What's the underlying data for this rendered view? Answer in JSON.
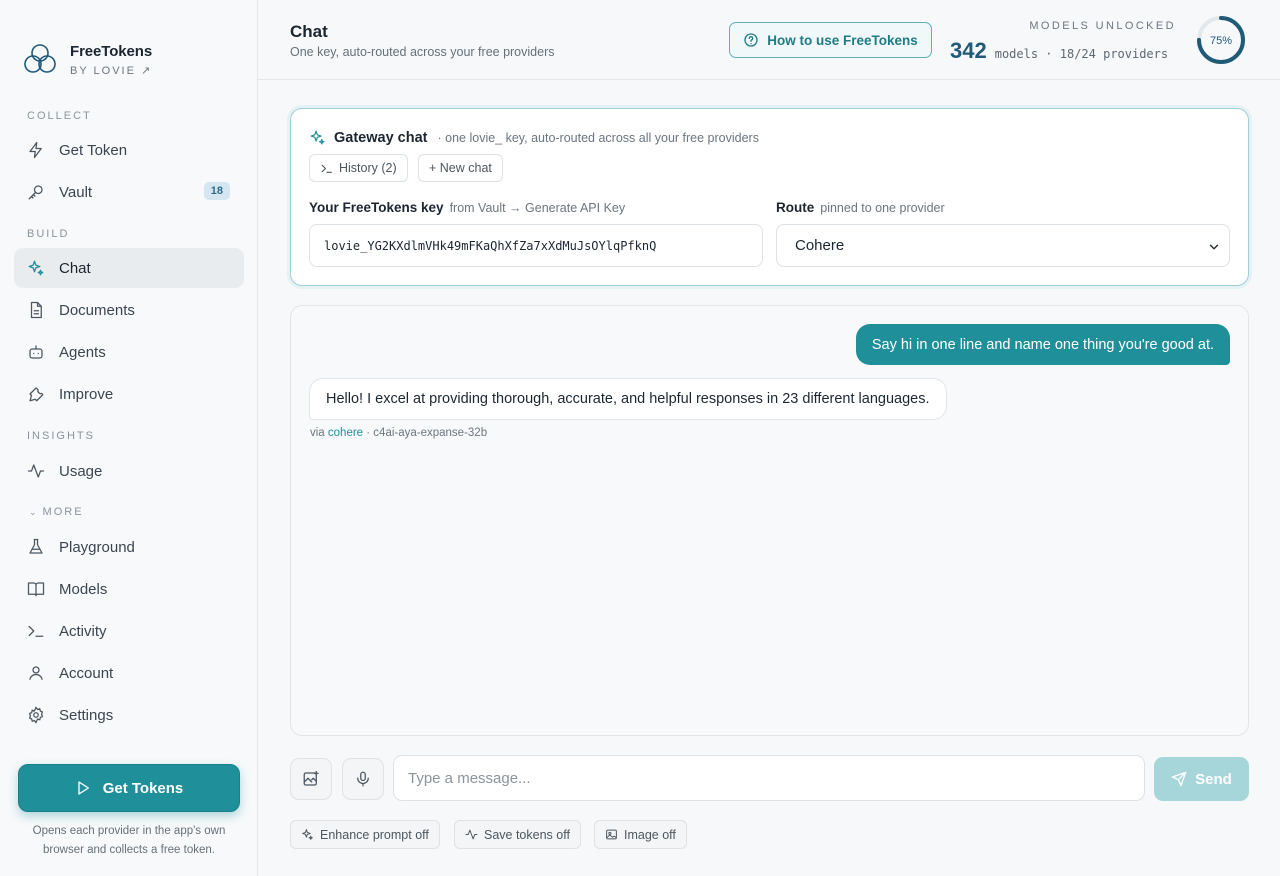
{
  "brand": {
    "name": "FreeTokens",
    "sub": "BY LOVIE ↗"
  },
  "sidebar": {
    "sections": {
      "collect": "COLLECT",
      "build": "BUILD",
      "insights": "INSIGHTS",
      "more": "MORE"
    },
    "items": [
      {
        "label": "Get Token",
        "icon": "lightning-icon"
      },
      {
        "label": "Vault",
        "icon": "key-icon",
        "badge": "18"
      },
      {
        "label": "Chat",
        "icon": "sparkles-icon",
        "active": true
      },
      {
        "label": "Documents",
        "icon": "document-icon"
      },
      {
        "label": "Agents",
        "icon": "robot-icon"
      },
      {
        "label": "Improve",
        "icon": "wrench-icon"
      },
      {
        "label": "Usage",
        "icon": "activity-icon"
      },
      {
        "label": "Playground",
        "icon": "flask-icon"
      },
      {
        "label": "Models",
        "icon": "book-icon"
      },
      {
        "label": "Activity",
        "icon": "terminal-icon"
      },
      {
        "label": "Account",
        "icon": "user-icon"
      },
      {
        "label": "Settings",
        "icon": "gear-icon"
      }
    ],
    "get_tokens_label": "Get Tokens",
    "get_tokens_note": "Opens each provider in the app's own browser and collects a free token."
  },
  "header": {
    "title": "Chat",
    "subtitle": "One key, auto-routed across your free providers",
    "howto_label": "How to use FreeTokens",
    "models_label": "MODELS UNLOCKED",
    "models_count": "342",
    "models_detail": "models · 18/24 providers",
    "progress_label": "75%",
    "progress": 0.75
  },
  "gateway": {
    "title": "Gateway chat",
    "subtitle": "· one lovie_ key, auto-routed across all your free providers",
    "history_label": "History (2)",
    "new_chat_label": "+ New chat",
    "key_label": "Your FreeTokens key",
    "key_hint": "from Vault → Generate API Key",
    "key_value": "lovie_YG2KXdlmVHk49mFKaQhXfZa7xXdMuJsOYlqPfknQ",
    "route_label": "Route",
    "route_hint": "pinned to one provider",
    "route_value": "Cohere"
  },
  "chat": {
    "user_message": "Say hi in one line and name one thing you're good at.",
    "bot_message": "Hello! I excel at providing thorough, accurate, and helpful responses in 23 different languages.",
    "meta_via": "via",
    "meta_provider": "cohere",
    "meta_model": "· c4ai-aya-expanse-32b"
  },
  "composer": {
    "placeholder": "Type a message...",
    "send_label": "Send",
    "enhance_label": "Enhance prompt off",
    "save_tokens_label": "Save tokens off",
    "image_label": "Image off"
  },
  "colors": {
    "accent": "#1f8f9a",
    "ring": "#1f5a78"
  }
}
